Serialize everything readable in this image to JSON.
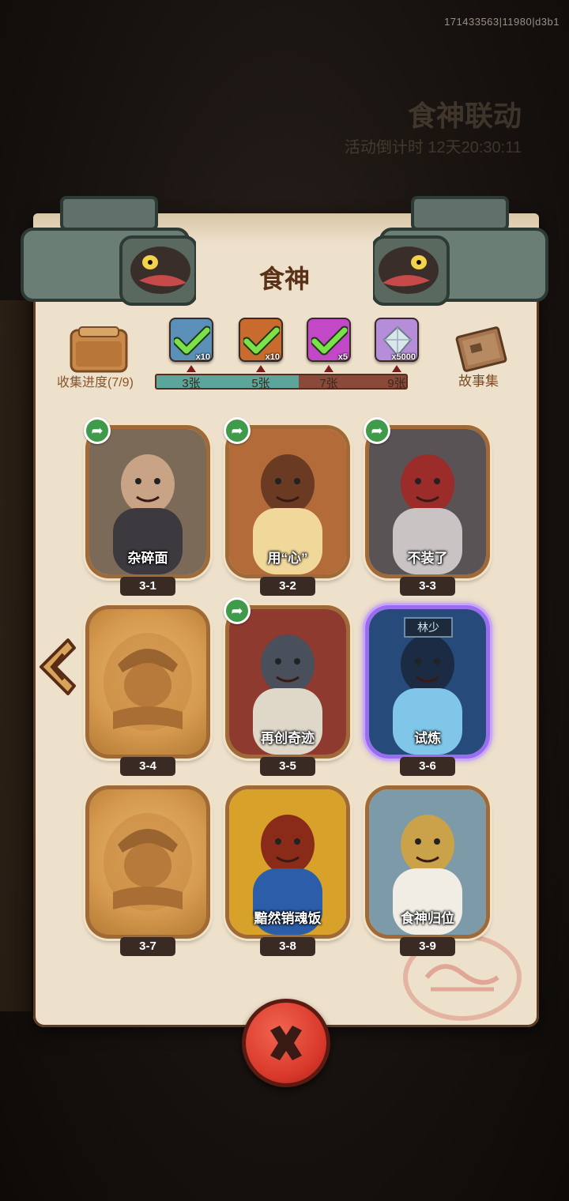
{
  "watermark": "171433563|11980|d3b1",
  "background": {
    "banner_title": "食神联动",
    "banner_sub": "活动倒计时 12天20:30:11"
  },
  "header": {
    "title": "食神"
  },
  "collection": {
    "label": "收集进度(7/9)",
    "story_label": "故事集",
    "progress_fraction": 0.57,
    "milestones": [
      {
        "label": "3张",
        "reward_qty": "x10",
        "reward_color": "#5a8fb8",
        "claimed": true
      },
      {
        "label": "5张",
        "reward_qty": "x10",
        "reward_color": "#c96a2e",
        "claimed": true
      },
      {
        "label": "7张",
        "reward_qty": "x5",
        "reward_color": "#c248c7",
        "claimed": true
      },
      {
        "label": "9张",
        "reward_qty": "x5000",
        "reward_color": "#b58dd9",
        "claimed": false
      }
    ]
  },
  "cards": [
    {
      "id": "3-1",
      "caption": "杂碎面",
      "unlocked": true,
      "shareable": true,
      "rare": false
    },
    {
      "id": "3-2",
      "caption": "用“心”",
      "unlocked": true,
      "shareable": true,
      "rare": false
    },
    {
      "id": "3-3",
      "caption": "不装了",
      "unlocked": true,
      "shareable": true,
      "rare": false
    },
    {
      "id": "3-4",
      "caption": "",
      "unlocked": false,
      "shareable": false,
      "rare": false
    },
    {
      "id": "3-5",
      "caption": "再创奇迹",
      "unlocked": true,
      "shareable": true,
      "rare": false
    },
    {
      "id": "3-6",
      "caption": "试炼",
      "unlocked": true,
      "shareable": false,
      "rare": true,
      "sign": "林少"
    },
    {
      "id": "3-7",
      "caption": "",
      "unlocked": false,
      "shareable": false,
      "rare": false
    },
    {
      "id": "3-8",
      "caption": "黯然销魂饭",
      "unlocked": true,
      "shareable": false,
      "rare": false
    },
    {
      "id": "3-9",
      "caption": "食神归位",
      "unlocked": true,
      "shareable": false,
      "rare": false
    }
  ],
  "icons": {
    "share": "share-arrow-icon",
    "close": "close-x-icon",
    "back": "left-arrow-icon"
  }
}
